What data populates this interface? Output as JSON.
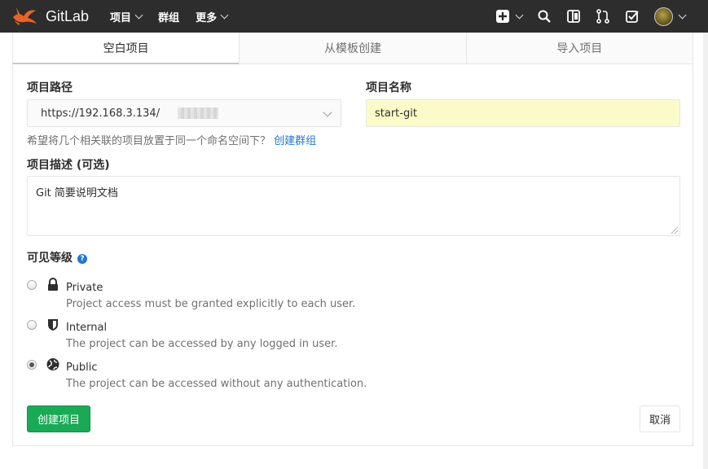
{
  "app": {
    "brand": "GitLab"
  },
  "nav": {
    "links": [
      {
        "label": "项目"
      },
      {
        "label": "群组"
      },
      {
        "label": "更多"
      }
    ]
  },
  "tabs": [
    {
      "label": "空白项目",
      "active": true
    },
    {
      "label": "从模板创建",
      "active": false
    },
    {
      "label": "导入项目",
      "active": false
    }
  ],
  "form": {
    "path_label": "项目路径",
    "path_value": "https://192.168.3.134/",
    "name_label": "项目名称",
    "name_value": "start-git",
    "hint_text": "希望将几个相关联的项目放置于同一个命名空间下？",
    "hint_link": "创建群组",
    "desc_label": "项目描述 (可选)",
    "desc_value": "Git 简要说明文档",
    "visibility_label": "可见等级",
    "visibility": [
      {
        "title": "Private",
        "desc": "Project access must be granted explicitly to each user.",
        "icon": "lock-icon",
        "checked": false
      },
      {
        "title": "Internal",
        "desc": "The project can be accessed by any logged in user.",
        "icon": "shield-icon",
        "checked": false
      },
      {
        "title": "Public",
        "desc": "The project can be accessed without any authentication.",
        "icon": "globe-icon",
        "checked": true
      }
    ],
    "create_button": "创建项目",
    "cancel_button": "取消"
  },
  "colors": {
    "navbar": "#2d2d2d",
    "accent_green": "#1aaa55",
    "name_input_bg": "#fbfbc9",
    "link_blue": "#1f78d1"
  }
}
